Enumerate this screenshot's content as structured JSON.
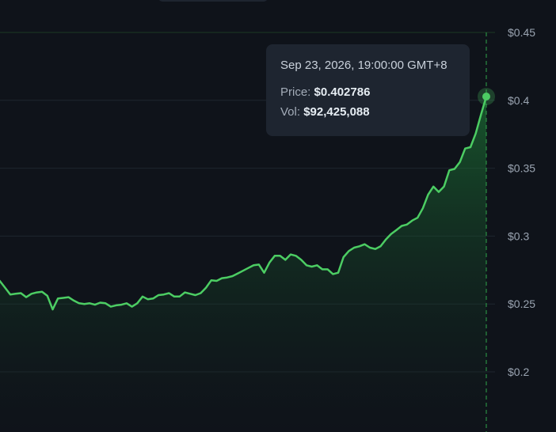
{
  "chart_data": {
    "type": "area",
    "y_ticks": [
      {
        "value": 0.45,
        "label": "$0.45"
      },
      {
        "value": 0.4,
        "label": "$0.4"
      },
      {
        "value": 0.35,
        "label": "$0.35"
      },
      {
        "value": 0.3,
        "label": "$0.3"
      },
      {
        "value": 0.25,
        "label": "$0.25"
      },
      {
        "value": 0.2,
        "label": "$0.2"
      }
    ],
    "ylim": [
      0.175,
      0.45
    ],
    "grid": true,
    "series": [
      {
        "values": [
          0.27,
          0.267,
          0.262,
          0.257,
          0.2575,
          0.258,
          0.255,
          0.2575,
          0.2585,
          0.259,
          0.256,
          0.246,
          0.254,
          0.2545,
          0.255,
          0.2525,
          0.2505,
          0.25,
          0.2505,
          0.2495,
          0.251,
          0.2505,
          0.248,
          0.249,
          0.2495,
          0.2505,
          0.248,
          0.2505,
          0.2555,
          0.2535,
          0.254,
          0.2565,
          0.257,
          0.258,
          0.2555,
          0.2555,
          0.2585,
          0.2575,
          0.2565,
          0.258,
          0.262,
          0.2675,
          0.267,
          0.269,
          0.2695,
          0.2705,
          0.2725,
          0.2745,
          0.2765,
          0.2785,
          0.279,
          0.273,
          0.2805,
          0.2855,
          0.2855,
          0.2825,
          0.2865,
          0.2855,
          0.2825,
          0.2785,
          0.2775,
          0.2785,
          0.2755,
          0.2755,
          0.272,
          0.273,
          0.2845,
          0.289,
          0.2915,
          0.2925,
          0.294,
          0.2915,
          0.2905,
          0.2925,
          0.2975,
          0.3015,
          0.3045,
          0.3075,
          0.3085,
          0.3115,
          0.3135,
          0.3205,
          0.3305,
          0.3365,
          0.3325,
          0.3365,
          0.3485,
          0.3495,
          0.3545,
          0.3645,
          0.3655,
          0.3755,
          0.3895,
          0.4028
        ]
      }
    ],
    "highlight_index": 93,
    "line_color": "#4ccd63",
    "crosshair_color": "#2fa64a"
  },
  "tooltip": {
    "date": "Sep 23, 2026, 19:00:00 GMT+8",
    "price_label": "Price:",
    "price_value": "$0.402786",
    "vol_label": "Vol:",
    "vol_value": "$92,425,088"
  }
}
